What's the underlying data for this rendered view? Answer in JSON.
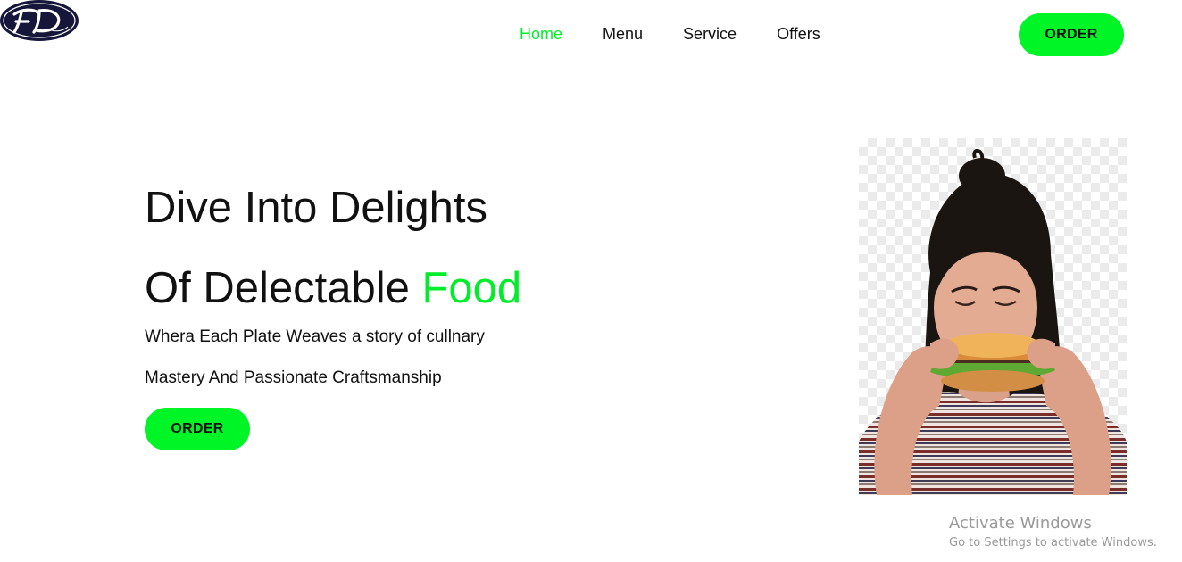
{
  "brand": {
    "logo_icon": "fd-monogram-logo-icon",
    "logo_text": "FD"
  },
  "nav": {
    "items": [
      {
        "label": "Home",
        "active": true
      },
      {
        "label": "Menu",
        "active": false
      },
      {
        "label": "Service",
        "active": false
      },
      {
        "label": "Offers",
        "active": false
      }
    ]
  },
  "header": {
    "order_label": "ORDER"
  },
  "hero": {
    "title_line1": "Dive Into Delights",
    "title_line2_prefix": "Of Delectable ",
    "title_line2_accent": "Food",
    "subtitle_line1": "Whera Each Plate Weaves a story of cullnary",
    "subtitle_line2": "Mastery And Passionate Craftsmanship",
    "order_label": "ORDER",
    "image_icon": "woman-eating-burger-image"
  },
  "watermark": {
    "title": "Activate Windows",
    "subtitle": "Go to Settings to activate Windows."
  },
  "colors": {
    "accent": "#00ee2a",
    "button": "#00f526",
    "text": "#111111",
    "logo_bg": "#1a1a3a"
  }
}
